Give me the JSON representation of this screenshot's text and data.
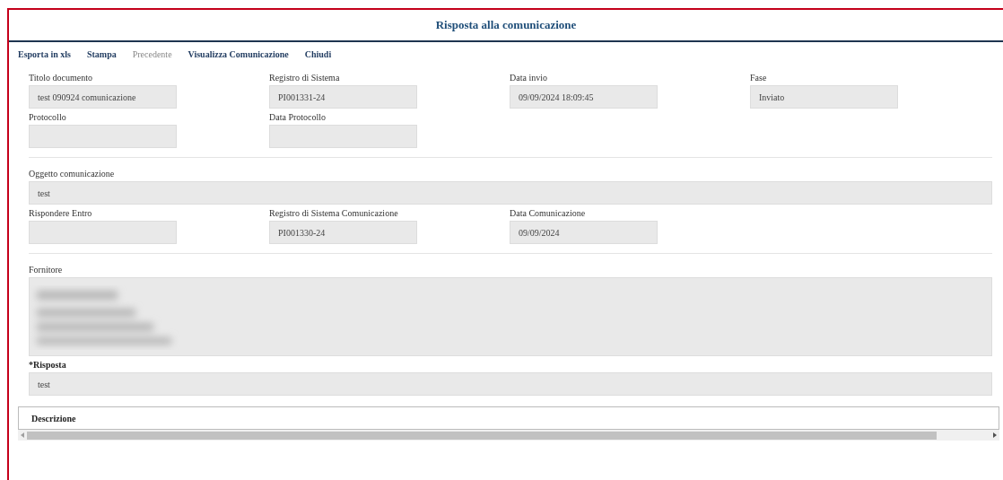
{
  "title": "Risposta alla comunicazione",
  "toolbar": [
    {
      "label": "Esporta in xls",
      "disabled": false
    },
    {
      "label": "Stampa",
      "disabled": false
    },
    {
      "label": "Precedente",
      "disabled": true
    },
    {
      "label": "Visualizza Comunicazione",
      "disabled": false
    },
    {
      "label": "Chiudi",
      "disabled": false
    }
  ],
  "sections": [
    {
      "fields": [
        {
          "label": "Titolo documento",
          "value": "test 090924 comunicazione",
          "kind": "short"
        },
        {
          "label": "Registro di Sistema",
          "value": "PI001331-24",
          "kind": "short"
        },
        {
          "label": "Data invio",
          "value": "09/09/2024 18:09:45",
          "kind": "short"
        },
        {
          "label": "Fase",
          "value": "Inviato",
          "kind": "short"
        },
        {
          "label": "Protocollo",
          "kind": "short"
        },
        {
          "label": "Data Protocollo",
          "kind": "short"
        }
      ]
    },
    {
      "fields": [
        {
          "label": "Oggetto comunicazione",
          "value": "test",
          "kind": "wide"
        },
        {
          "label": "Rispondere Entro",
          "kind": "short"
        },
        {
          "label": "Registro di Sistema Comunicazione",
          "value": "PI001330-24",
          "kind": "short"
        },
        {
          "label": "Data Comunicazione",
          "value": "09/09/2024",
          "kind": "short"
        }
      ]
    },
    {
      "fields": [
        {
          "label": "Fornitore",
          "kind": "redacted"
        },
        {
          "label": "*Risposta",
          "value": "test",
          "kind": "wide",
          "required": true
        }
      ]
    }
  ],
  "table": {
    "header": "Descrizione"
  }
}
